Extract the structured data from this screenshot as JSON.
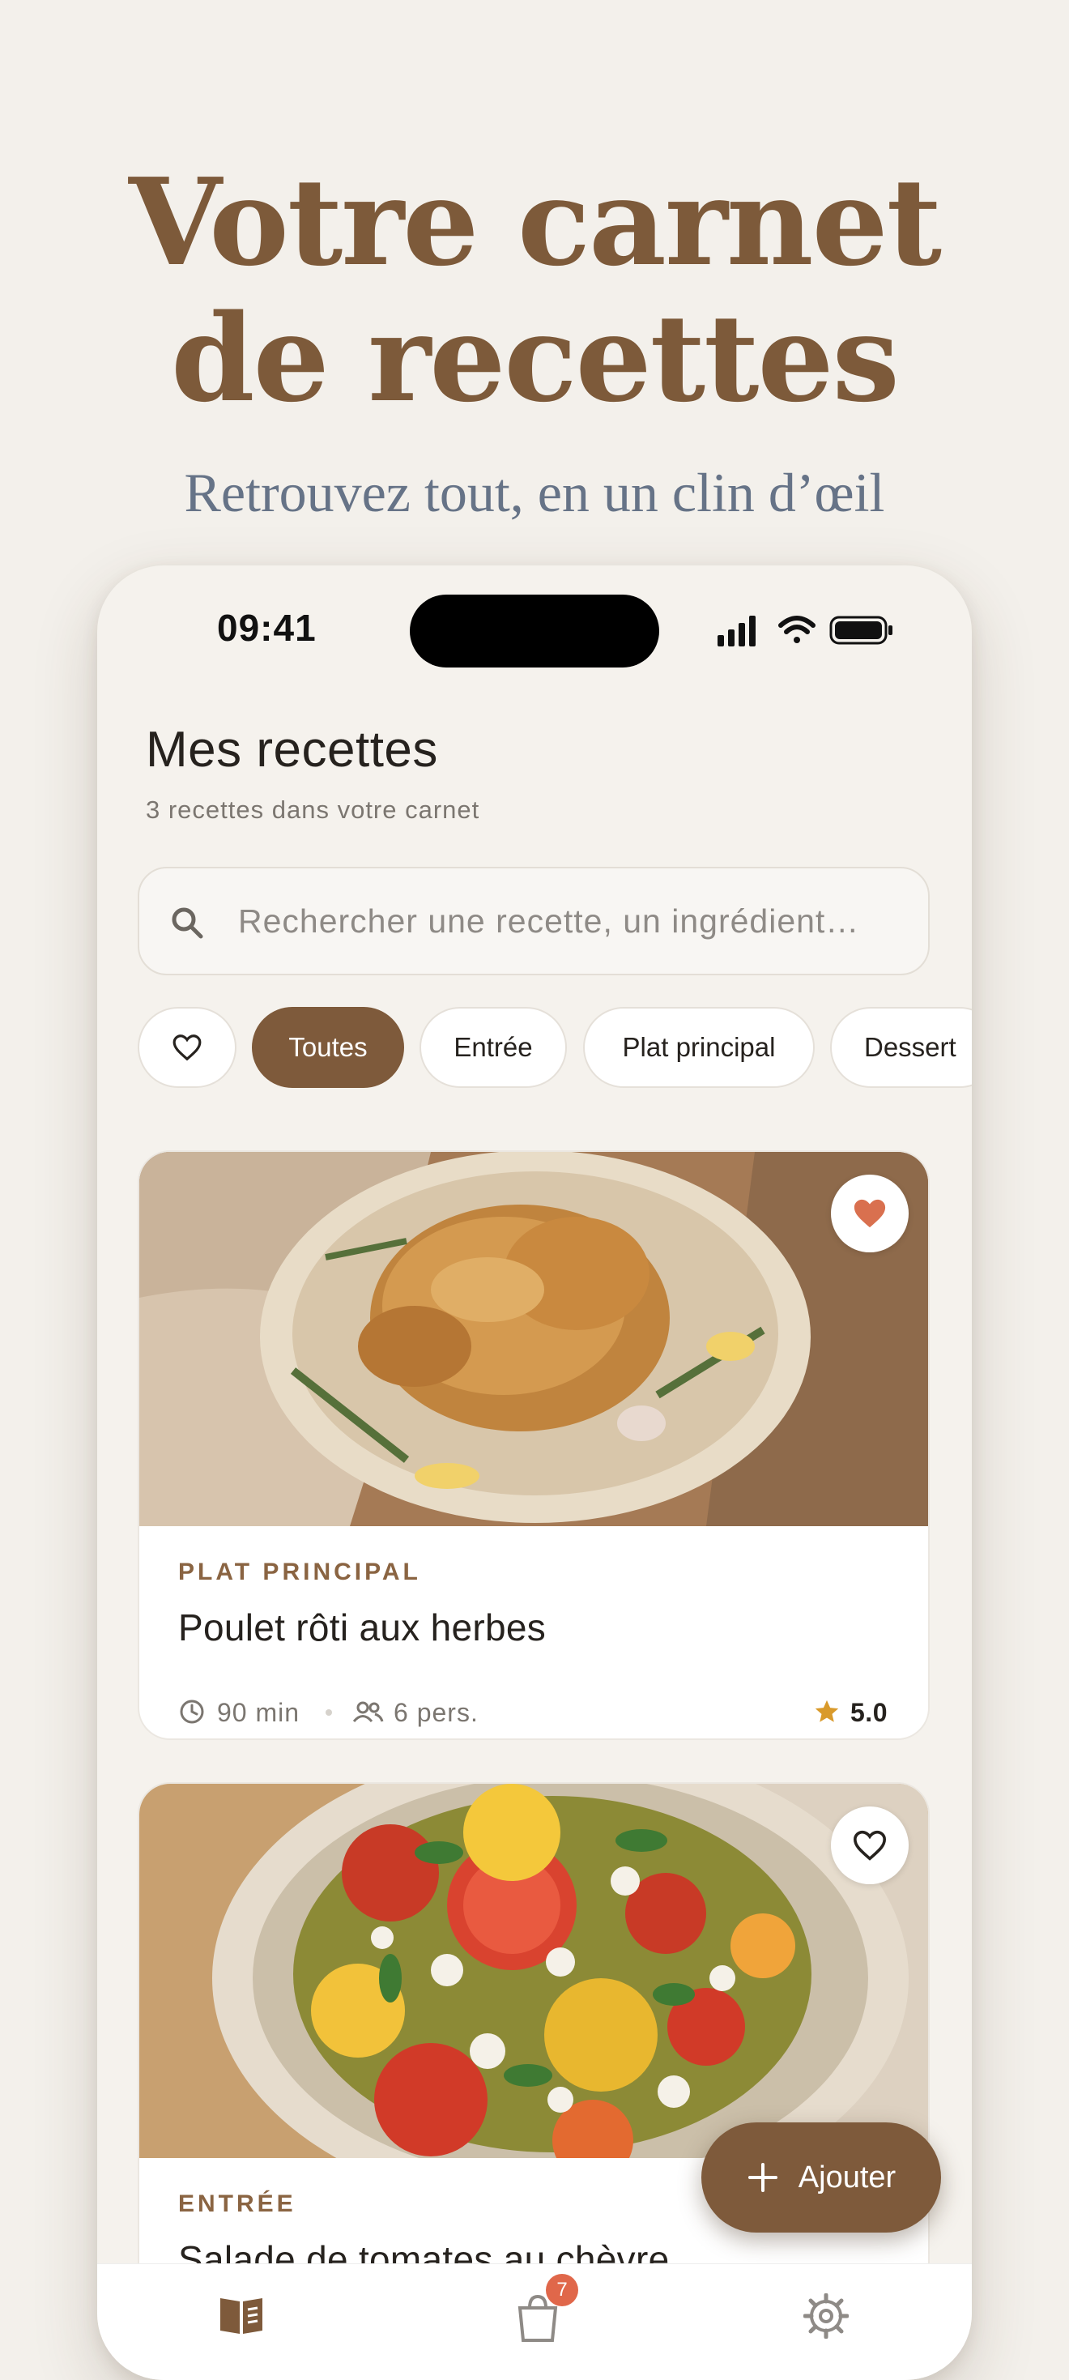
{
  "hero": {
    "title_line1": "Votre carnet",
    "title_line2": "de recettes",
    "subtitle": "Retrouvez tout, en un clin d’œil"
  },
  "status_bar": {
    "time": "09:41"
  },
  "screen": {
    "title": "Mes recettes",
    "subtitle": "3 recettes dans votre carnet"
  },
  "search": {
    "placeholder": "Rechercher une recette, un ingrédient…",
    "value": ""
  },
  "filters": {
    "favorites_icon": "heart-outline-icon",
    "chips": [
      {
        "label": "Toutes",
        "active": true
      },
      {
        "label": "Entrée",
        "active": false
      },
      {
        "label": "Plat principal",
        "active": false
      },
      {
        "label": "Dessert",
        "active": false
      }
    ]
  },
  "recipes": [
    {
      "category": "PLAT PRINCIPAL",
      "title": "Poulet rôti aux herbes",
      "time": "90 min",
      "servings": "6 pers.",
      "rating": "5.0",
      "favorite": true
    },
    {
      "category": "ENTRÉE",
      "title": "Salade de tomates au chèvre",
      "favorite": false
    }
  ],
  "fab": {
    "label": "Ajouter",
    "icon": "plus-icon"
  },
  "tabbar": {
    "items": [
      {
        "icon": "book-icon",
        "active": true
      },
      {
        "icon": "shopping-bag-icon",
        "badge": "7"
      },
      {
        "icon": "gear-icon"
      }
    ]
  },
  "colors": {
    "brand": "#7e5a3b",
    "background": "#f3f0eb",
    "favorite_heart": "#d9704f",
    "star": "#d99a2b",
    "badge": "#e0674a"
  }
}
